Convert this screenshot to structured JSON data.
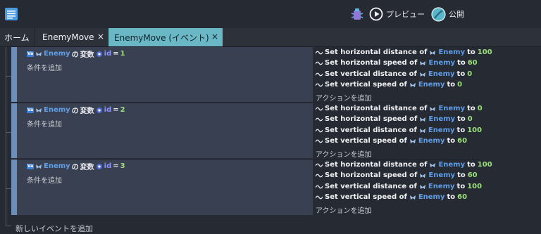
{
  "toolbar": {
    "preview_label": "プレビュー",
    "publish_label": "公開"
  },
  "tabs": [
    {
      "label": "ホーム"
    },
    {
      "label": "EnemyMove",
      "close": "×"
    },
    {
      "label": "EnemyMove (イベント)",
      "close": "×"
    }
  ],
  "events": [
    {
      "condition": {
        "object": "Enemy",
        "no": "の",
        "var_label": "変数",
        "var_name": "id",
        "op": "=",
        "value": "1"
      },
      "add_condition": "条件を追加",
      "actions": [
        {
          "text": "Set horizontal distance of",
          "object": "Enemy",
          "to": "to",
          "value": "100"
        },
        {
          "text": "Set horizontal speed of",
          "object": "Enemy",
          "to": "to",
          "value": "60"
        },
        {
          "text": "Set vertical distance of",
          "object": "Enemy",
          "to": "to",
          "value": "0"
        },
        {
          "text": "Set vertical speed of",
          "object": "Enemy",
          "to": "to",
          "value": "0"
        }
      ],
      "add_action": "アクションを追加"
    },
    {
      "condition": {
        "object": "Enemy",
        "no": "の",
        "var_label": "変数",
        "var_name": "id",
        "op": "=",
        "value": "2"
      },
      "add_condition": "条件を追加",
      "actions": [
        {
          "text": "Set horizontal distance of",
          "object": "Enemy",
          "to": "to",
          "value": "0"
        },
        {
          "text": "Set horizontal speed of",
          "object": "Enemy",
          "to": "to",
          "value": "0"
        },
        {
          "text": "Set vertical distance of",
          "object": "Enemy",
          "to": "to",
          "value": "100"
        },
        {
          "text": "Set vertical speed of",
          "object": "Enemy",
          "to": "to",
          "value": "60"
        }
      ],
      "add_action": "アクションを追加"
    },
    {
      "condition": {
        "object": "Enemy",
        "no": "の",
        "var_label": "変数",
        "var_name": "id",
        "op": "=",
        "value": "3"
      },
      "add_condition": "条件を追加",
      "actions": [
        {
          "text": "Set horizontal distance of",
          "object": "Enemy",
          "to": "to",
          "value": "100"
        },
        {
          "text": "Set horizontal speed of",
          "object": "Enemy",
          "to": "to",
          "value": "60"
        },
        {
          "text": "Set vertical distance of",
          "object": "Enemy",
          "to": "to",
          "value": "100"
        },
        {
          "text": "Set vertical speed of",
          "object": "Enemy",
          "to": "to",
          "value": "60"
        }
      ],
      "add_action": "アクションを追加"
    }
  ],
  "add_event": "新しいイベントを追加",
  "colors": {
    "background": "#262a33",
    "condition_bg": "#394052",
    "event_bar": "#6b8fb8",
    "active_tab": "#6ab7c6",
    "object_name": "#5f9ee8",
    "number": "#9be07a",
    "variable_name": "#8a93ff"
  },
  "icons": {
    "menu": "document-list-icon",
    "debug": "bug-icon",
    "preview": "play-circle-icon",
    "publish": "globe-icon",
    "action": "wave-icon"
  }
}
